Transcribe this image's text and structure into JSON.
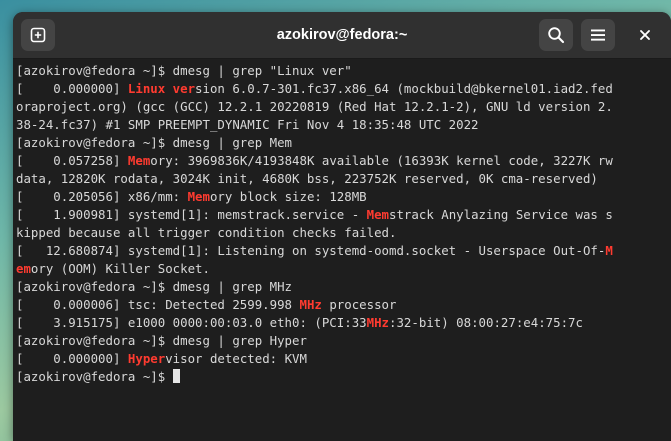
{
  "window": {
    "title": "azokirov@fedora:~"
  },
  "titlebar": {
    "new_tab_icon": "new-tab-icon",
    "search_icon": "search-icon",
    "menu_icon": "hamburger-menu-icon",
    "close_icon": "close-icon"
  },
  "colors": {
    "highlight": "#ff3b30",
    "terminal_bg": "#1e1e1e",
    "terminal_fg": "#d8d8d8",
    "titlebar_bg": "#303030"
  },
  "terminal": {
    "lines": [
      [
        "[azokirov@fedora ~]$ dmesg | grep \"Linux ver\""
      ],
      [
        "[    0.000000] ",
        {
          "h": "Linux ver"
        },
        "sion 6.0.7-301.fc37.x86_64 (mockbuild@bkernel01.iad2.fed"
      ],
      [
        "oraproject.org) (gcc (GCC) 12.2.1 20220819 (Red Hat 12.2.1-2), GNU ld version 2."
      ],
      [
        "38-24.fc37) #1 SMP PREEMPT_DYNAMIC Fri Nov 4 18:35:48 UTC 2022"
      ],
      [
        "[azokirov@fedora ~]$ dmesg | grep Mem"
      ],
      [
        "[    0.057258] ",
        {
          "h": "Mem"
        },
        "ory: 3969836K/4193848K available (16393K kernel code, 3227K rw"
      ],
      [
        "data, 12820K rodata, 3024K init, 4680K bss, 223752K reserved, 0K cma-reserved)"
      ],
      [
        "[    0.205056] x86/mm: ",
        {
          "h": "Mem"
        },
        "ory block size: 128MB"
      ],
      [
        "[    1.900981] systemd[1]: memstrack.service - ",
        {
          "h": "Mem"
        },
        "strack Anylazing Service was s"
      ],
      [
        "kipped because all trigger condition checks failed."
      ],
      [
        "[   12.680874] systemd[1]: Listening on systemd-oomd.socket - Userspace Out-Of-",
        {
          "h": "M"
        }
      ],
      [
        {
          "h": "em"
        },
        "ory (OOM) Killer Socket."
      ],
      [
        "[azokirov@fedora ~]$ dmesg | grep MHz"
      ],
      [
        "[    0.000006] tsc: Detected 2599.998 ",
        {
          "h": "MHz"
        },
        " processor"
      ],
      [
        "[    3.915175] e1000 0000:00:03.0 eth0: (PCI:33",
        {
          "h": "MHz"
        },
        ":32-bit) 08:00:27:e4:75:7c"
      ],
      [
        "[azokirov@fedora ~]$ dmesg | grep Hyper"
      ],
      [
        "[    0.000000] ",
        {
          "h": "Hyper"
        },
        "visor detected: KVM"
      ],
      [
        "[azokirov@fedora ~]$ ",
        {
          "cursor": true
        }
      ]
    ]
  }
}
